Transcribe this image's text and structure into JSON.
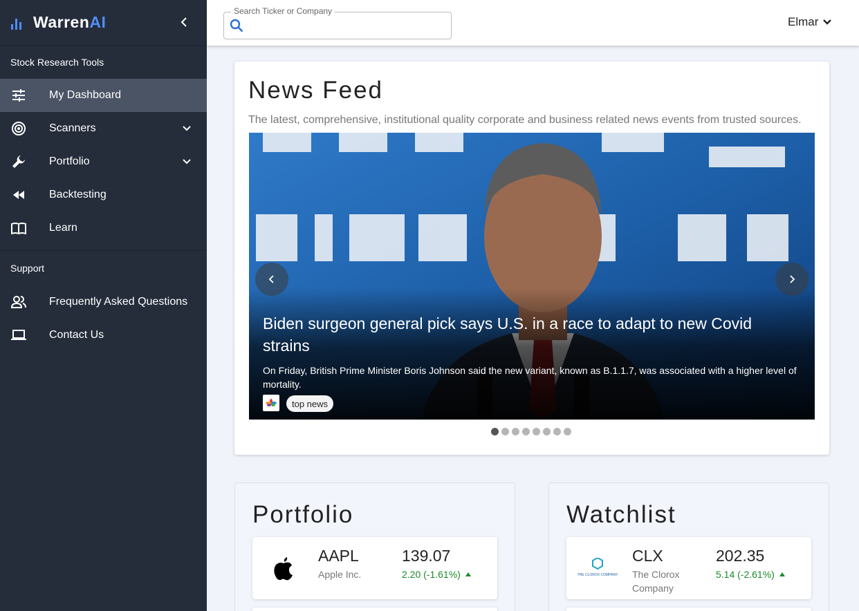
{
  "brand": {
    "name_main": "Warren",
    "name_accent": "AI",
    "accent_color": "#4f8ef7"
  },
  "sidebar": {
    "section_tools": "Stock Research Tools",
    "items": [
      {
        "label": "My Dashboard",
        "icon": "sliders-icon",
        "active": true
      },
      {
        "label": "Scanners",
        "icon": "radar-icon",
        "expandable": true
      },
      {
        "label": "Portfolio",
        "icon": "wrench-icon",
        "expandable": true
      },
      {
        "label": "Backtesting",
        "icon": "rewind-icon"
      },
      {
        "label": "Learn",
        "icon": "book-icon"
      }
    ],
    "section_support": "Support",
    "support_items": [
      {
        "label": "Frequently Asked Questions",
        "icon": "people-icon"
      },
      {
        "label": "Contact Us",
        "icon": "laptop-icon"
      }
    ]
  },
  "header": {
    "search_label": "Search Ticker or Company",
    "search_value": "",
    "user_name": "Elmar"
  },
  "news": {
    "title": "News Feed",
    "subtitle": "The latest, comprehensive, institutional quality corporate and business related news events from trusted sources.",
    "headline": "Biden surgeon general pick says U.S. in a race to adapt to new Covid strains",
    "summary": "On Friday, British Prime Minister Boris Johnson said the new variant, known as B.1.1.7, was associated with a higher level of mortality.",
    "tag": "top news",
    "slide_count": 8,
    "active_slide": 1
  },
  "portfolio": {
    "title": "Portfolio",
    "stocks": [
      {
        "ticker": "AAPL",
        "company": "Apple Inc.",
        "price": "139.07",
        "change": "2.20 (-1.61%)",
        "logo": "apple-logo"
      }
    ]
  },
  "watchlist": {
    "title": "Watchlist",
    "stocks": [
      {
        "ticker": "CLX",
        "company": "The Clorox Company",
        "price": "202.35",
        "change": "5.14 (-2.61%)",
        "logo": "clorox-logo",
        "logo_text": "THE CLOROX COMPANY"
      }
    ]
  },
  "colors": {
    "sidebar_bg": "#252d3b",
    "active_item": "#4b5465",
    "positive": "#1a8a2a",
    "page_bg": "#f1f3fb"
  }
}
